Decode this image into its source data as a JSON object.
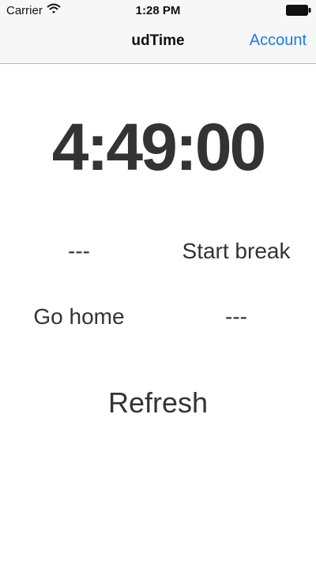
{
  "status_bar": {
    "carrier": "Carrier",
    "time": "1:28 PM"
  },
  "nav": {
    "title": "udTime",
    "account": "Account"
  },
  "main": {
    "clock": "4:49:00",
    "row1": {
      "left": "---",
      "right": "Start break"
    },
    "row2": {
      "left": "Go home",
      "right": "---"
    },
    "refresh": "Refresh"
  },
  "colors": {
    "accent": "#1a7cf0",
    "text": "#333333",
    "bar": "#f7f7f7"
  }
}
